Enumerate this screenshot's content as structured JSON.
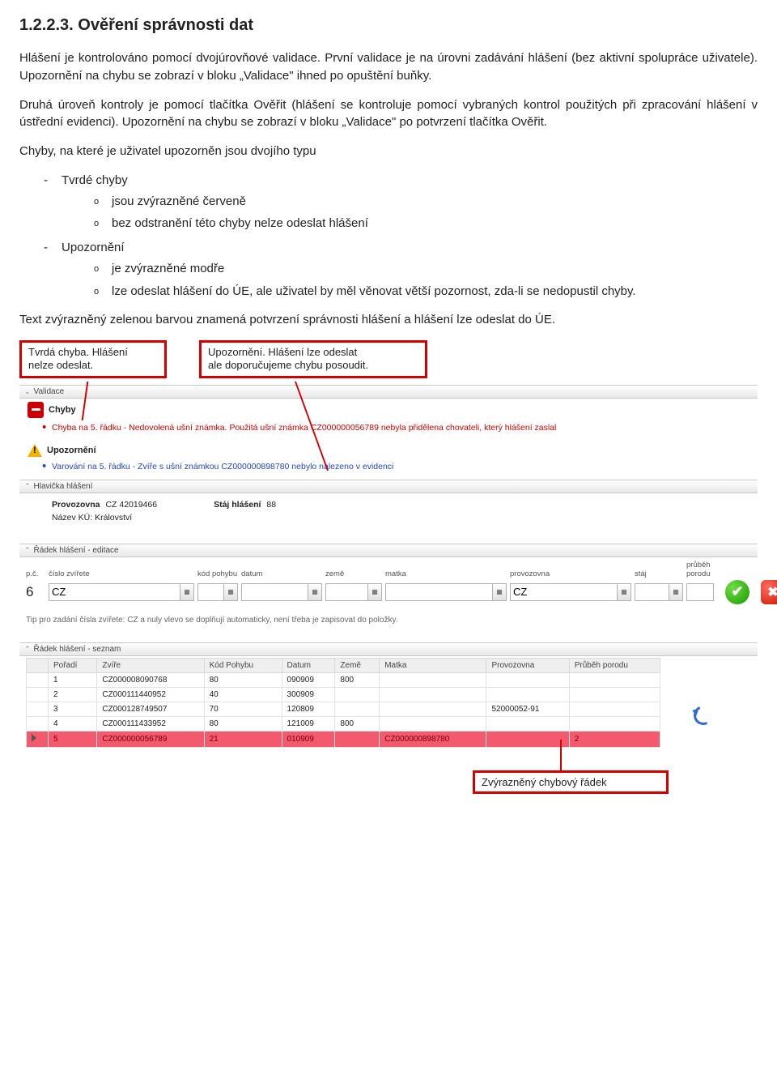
{
  "heading": "1.2.2.3. Ověření správnosti dat",
  "para1": "Hlášení je kontrolováno pomocí dvojúrovňové validace. První validace je na úrovni zadávání hlášení (bez aktivní spolupráce uživatele). Upozornění na chybu se zobrazí v bloku „Validace\" ihned po opuštění buňky.",
  "para2": "Druhá úroveň kontroly je pomocí tlačítka Ověřit (hlášení se kontroluje pomocí vybraných kontrol použitých při zpracování hlášení v ústřední evidenci). Upozornění na chybu se zobrazí v bloku „Validace\" po potvrzení tlačítka Ověřit.",
  "errors_intro": "Chyby, na které je uživatel upozorněn jsou dvojího typu",
  "list": {
    "a": "Tvrdé chyby",
    "a1": "jsou zvýrazněné červeně",
    "a2": "bez odstranění této chyby nelze odeslat hlášení",
    "b": "Upozornění",
    "b1": "je zvýrazněné modře",
    "b2": "lze odeslat hlášení do ÚE, ale uživatel by měl věnovat větší pozornost, zda-li se nedopustil chyby."
  },
  "green_text": "Text zvýrazněný zelenou barvou znamená potvrzení správnosti hlášení a hlášení lze odeslat do ÚE.",
  "annot": {
    "left1": "Tvrdá chyba. Hlášení",
    "left2": "nelze odeslat.",
    "right1": "Upozornění. Hlášení lze odeslat",
    "right2": "ale doporučujeme chybu posoudit."
  },
  "shot": {
    "validace_head": "Validace",
    "chyby_label": "Chyby",
    "chyba_text": "Chyba na 5. řádku - Nedovolená ušní známka. Použitá ušní známka CZ000000056789 nebyla přidělena chovateli, který hlášení zaslal",
    "upoz_label": "Upozornění",
    "upoz_text": "Varování na 5. řádku - Zvíře s ušní známkou CZ000000898780 nebylo nalezeno v evidenci",
    "hlavicka_head": "Hlavička hlášení",
    "hlav": {
      "prov_label": "Provozovna",
      "prov_val": "CZ 42019466",
      "nazev_label": "Název KÚ:",
      "nazev_val": "Království",
      "staj_label": "Stáj hlášení",
      "staj_val": "88"
    },
    "edit_head": "Řádek hlášení - editace",
    "cols": {
      "pc": "p.č.",
      "cislo": "číslo zvířete",
      "kod": "kód pohybu",
      "datum": "datum",
      "zeme": "země",
      "matka": "matka",
      "provoz": "provozovna",
      "staj": "stáj",
      "porod": "průběh porodu"
    },
    "edit_row": {
      "num": "6",
      "cislo_val": "CZ",
      "provoz_val": "CZ"
    },
    "tip": "Tip pro zadání čísla zvířete: CZ a nuly vlevo se doplňují automaticky, není třeba je zapisovat do položky.",
    "seznam_head": "Řádek hlášení - seznam",
    "list_cols": {
      "poradi": "Pořadí",
      "zvire": "Zvíře",
      "kod": "Kód Pohybu",
      "datum": "Datum",
      "zeme": "Země",
      "matka": "Matka",
      "provoz": "Provozovna",
      "porod": "Průběh porodu"
    },
    "rows": [
      {
        "poradi": "1",
        "zvire": "CZ000008090768",
        "kod": "80",
        "datum": "090909",
        "zeme": "800",
        "matka": "",
        "provoz": "",
        "porod": ""
      },
      {
        "poradi": "2",
        "zvire": "CZ000111440952",
        "kod": "40",
        "datum": "300909",
        "zeme": "",
        "matka": "",
        "provoz": "",
        "porod": ""
      },
      {
        "poradi": "3",
        "zvire": "CZ000128749507",
        "kod": "70",
        "datum": "120809",
        "zeme": "",
        "matka": "",
        "provoz": "52000052-91",
        "porod": ""
      },
      {
        "poradi": "4",
        "zvire": "CZ000111433952",
        "kod": "80",
        "datum": "121009",
        "zeme": "800",
        "matka": "",
        "provoz": "",
        "porod": ""
      },
      {
        "poradi": "5",
        "zvire": "CZ000000056789",
        "kod": "21",
        "datum": "010909",
        "zeme": "",
        "matka": "CZ000000898780",
        "provoz": "",
        "porod": "2"
      }
    ]
  },
  "bottom_annot": "Zvýrazněný chybový řádek"
}
